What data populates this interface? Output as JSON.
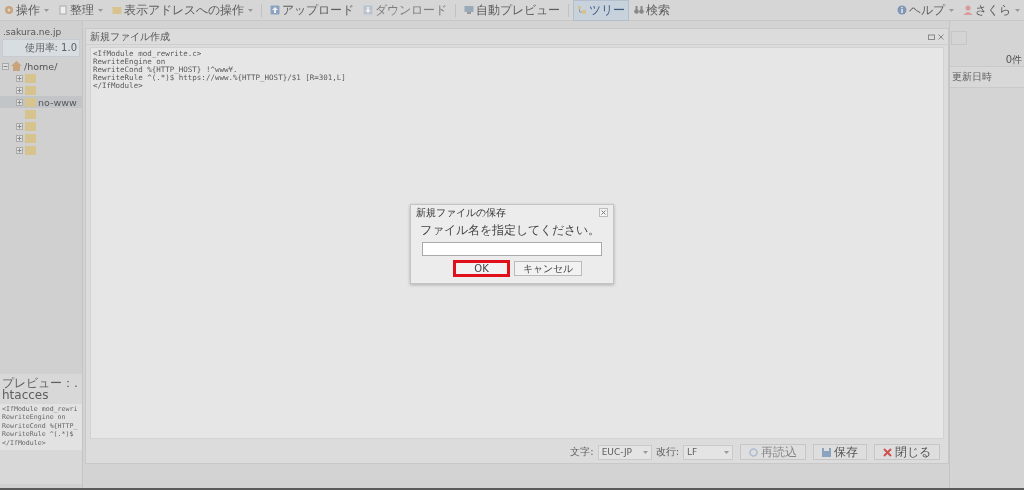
{
  "toolbar": {
    "groups": [
      [
        {
          "label": "操作",
          "dropdown": true,
          "disabled": false,
          "selected": false
        },
        {
          "label": "整理",
          "dropdown": true,
          "disabled": false,
          "selected": false
        },
        {
          "label": "表示アドレスへの操作",
          "dropdown": true,
          "disabled": false,
          "selected": false
        }
      ],
      [
        {
          "label": "アップロード",
          "dropdown": false,
          "disabled": false,
          "selected": false
        },
        {
          "label": "ダウンロード",
          "dropdown": false,
          "disabled": true,
          "selected": false
        }
      ],
      [
        {
          "label": "自動プレビュー",
          "dropdown": false,
          "disabled": false,
          "selected": false
        }
      ],
      [
        {
          "label": "ツリー",
          "dropdown": false,
          "disabled": false,
          "selected": true
        },
        {
          "label": "検索",
          "dropdown": false,
          "disabled": false,
          "selected": false
        }
      ]
    ],
    "right": [
      {
        "label": "ヘルプ",
        "dropdown": true
      },
      {
        "label": "さくら",
        "dropdown": true
      }
    ]
  },
  "sidebar": {
    "host": ".sakura.ne.jp",
    "usage": "使用率: 1.0",
    "tree": [
      {
        "label": "/home/",
        "expanded": true,
        "children": [
          {
            "expandable": true,
            "selected": false
          },
          {
            "expandable": true,
            "selected": false
          },
          {
            "label": "no-www",
            "expandable": true,
            "selected": true
          },
          {
            "expandable": false,
            "selected": false
          },
          {
            "expandable": true,
            "selected": false
          },
          {
            "expandable": true,
            "selected": false
          },
          {
            "expandable": true,
            "selected": false
          }
        ]
      }
    ],
    "preview": {
      "title": "プレビュー：.htacces",
      "lines": [
        "<IfModule mod_rewri",
        "RewriteEngine on",
        "RewriteCond %{HTTP_",
        "RewriteRule ^(.*)$",
        "</IfModule>"
      ]
    }
  },
  "editor": {
    "title": "新規ファイル作成",
    "lines": [
      "<IfModule mod_rewrite.c>",
      "RewriteEngine on",
      "RewriteCond %{HTTP_HOST} !^www¥.",
      "RewriteRule ^(.*)$ https://www.%{HTTP_HOST}/$1 [R=301,L]",
      "</IfModule>"
    ],
    "encoding_label": "文字:",
    "encoding": "EUC-JP",
    "newline_label": "改行:",
    "newline": "LF",
    "buttons": [
      {
        "label": "再読込",
        "disabled": true
      },
      {
        "label": "保存",
        "disabled": false
      },
      {
        "label": "閉じる",
        "disabled": false
      }
    ]
  },
  "right_panel": {
    "count": "0件",
    "column": "更新日時"
  },
  "dialog": {
    "title": "新規ファイルの保存",
    "message": "ファイル名を指定してください。",
    "buttons": [
      {
        "label": "OK",
        "highlighted": true
      },
      {
        "label": "キャンセル",
        "highlighted": false
      }
    ]
  }
}
